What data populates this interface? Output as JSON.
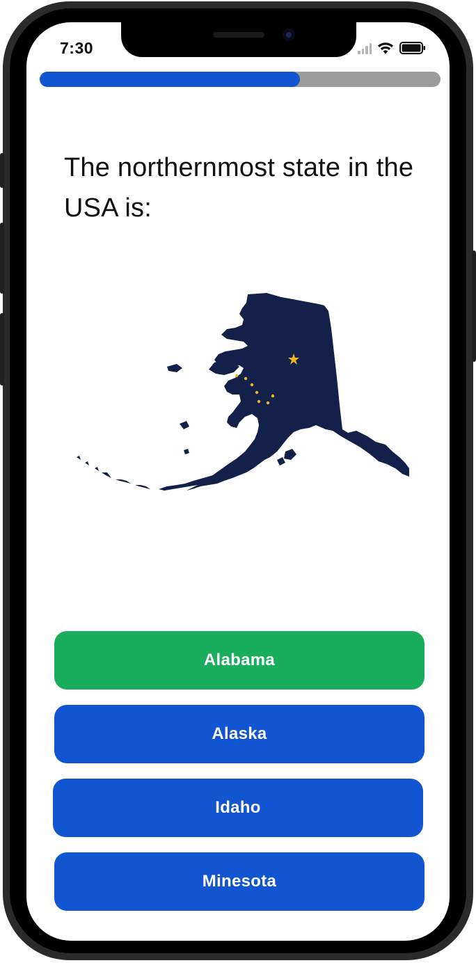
{
  "status_bar": {
    "time": "7:30",
    "icons": [
      "cellular-signal-icon",
      "wifi-icon",
      "battery-icon"
    ]
  },
  "quiz": {
    "progress_fraction": 0.65,
    "question": "The northernmost state in the USA is:",
    "image_icon": "alaska-map-icon",
    "answers": [
      {
        "label": "Alabama",
        "state": "correct"
      },
      {
        "label": "Alaska",
        "state": "default"
      },
      {
        "label": "Idaho",
        "state": "default"
      },
      {
        "label": "Minesota",
        "state": "default"
      }
    ]
  },
  "colors": {
    "primary_blue": "#1155d0",
    "correct_green": "#18ae5e",
    "progress_track": "#9b9b9b",
    "map_navy": "#12204a",
    "star_gold": "#f2b51f"
  }
}
